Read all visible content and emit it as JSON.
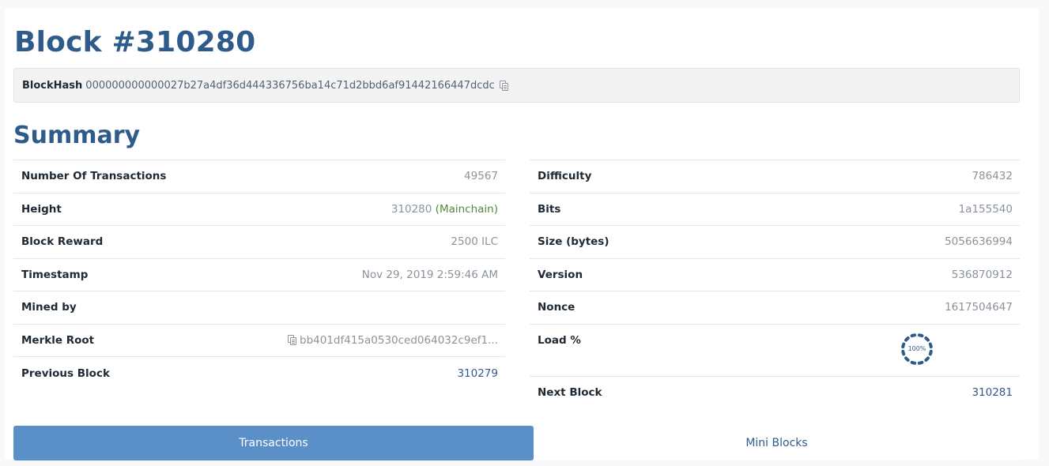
{
  "page": {
    "title": "Block #310280"
  },
  "hash_bar": {
    "label": "BlockHash",
    "value": "000000000000027b27a4df36d444336756ba14c71d2bbd6af91442166447dcdc",
    "icon": "copy-icon"
  },
  "summary": {
    "title": "Summary",
    "left": [
      {
        "label": "Number Of Transactions",
        "value": "49567"
      },
      {
        "label": "Height",
        "value": "310280",
        "suffix": "(Mainchain)"
      },
      {
        "label": "Block Reward",
        "value": "2500 ILC"
      },
      {
        "label": "Timestamp",
        "value": "Nov 29, 2019 2:59:46 AM"
      },
      {
        "label": "Mined by",
        "value": ""
      },
      {
        "label": "Merkle Root",
        "value": "bb401df415a0530ced064032c9ef1...",
        "icon": "copy-icon"
      },
      {
        "label": "Previous Block",
        "value": "310279"
      }
    ],
    "right": [
      {
        "label": "Difficulty",
        "value": "786432"
      },
      {
        "label": "Bits",
        "value": "1a155540"
      },
      {
        "label": "Size (bytes)",
        "value": "5056636994"
      },
      {
        "label": "Version",
        "value": "536870912"
      },
      {
        "label": "Nonce",
        "value": "1617504647"
      },
      {
        "label": "Load %",
        "value": "100%",
        "load_fraction": 1.0
      },
      {
        "label": "Next Block",
        "value": "310281"
      }
    ]
  },
  "tabs": {
    "transactions": "Transactions",
    "mini_blocks": "Mini Blocks",
    "active": "Transactions"
  },
  "colors": {
    "heading": "#2f5b8a",
    "link": "#2f5b8a",
    "mainchain": "#4e8a3e",
    "active_tab": "#5b8fc7"
  }
}
